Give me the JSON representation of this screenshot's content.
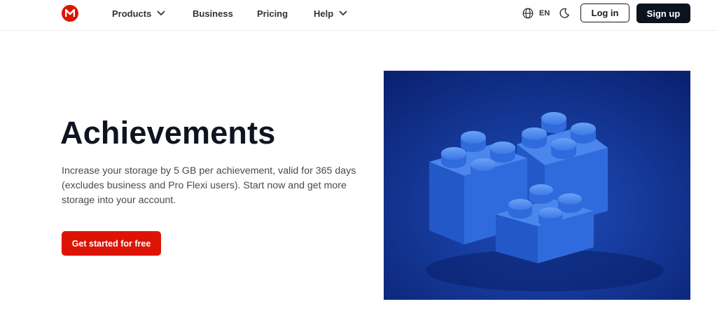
{
  "header": {
    "logo_icon": "mega-logo-icon",
    "nav": {
      "products_label": "Products",
      "business_label": "Business",
      "pricing_label": "Pricing",
      "help_label": "Help"
    },
    "language": {
      "icon": "globe-icon",
      "label": "EN"
    },
    "theme_icon": "moon-icon",
    "login_label": "Log in",
    "signup_label": "Sign up"
  },
  "hero": {
    "title": "Achievements",
    "description": "Increase your storage by 5 GB per achievement, valid for 365 days (excludes business and Pro Flexi users). Start now and get more storage into your account.",
    "cta_label": "Get started for free",
    "image_subject": "blue-building-blocks-illustration"
  },
  "colors": {
    "brand_red": "#dd1405",
    "dark_button": "#0b1220",
    "image_bg": "#0f2f82",
    "block_blue": "#2f6fe0"
  }
}
